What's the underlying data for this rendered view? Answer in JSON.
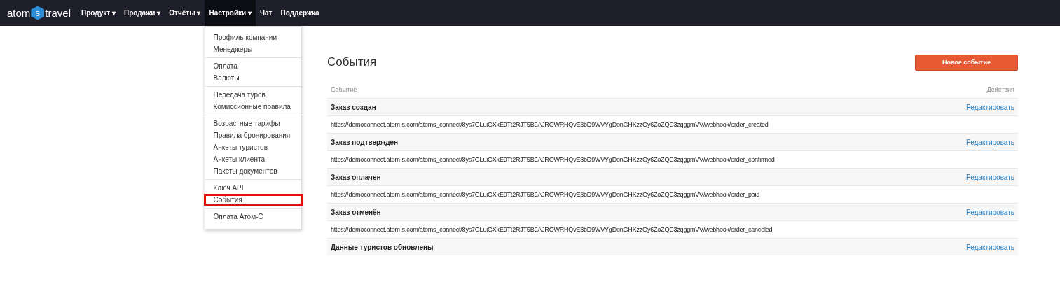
{
  "logo": {
    "left": "atom",
    "badge": "s",
    "right": "travel"
  },
  "nav": [
    {
      "label": "Продукт",
      "caret": "▾",
      "selected": false
    },
    {
      "label": "Продажи",
      "caret": "▾",
      "selected": false
    },
    {
      "label": "Отчёты",
      "caret": "▾",
      "selected": false
    },
    {
      "label": "Настройки",
      "caret": "▾",
      "selected": true
    },
    {
      "label": "Чат",
      "selected": false
    },
    {
      "label": "Поддержка",
      "selected": false
    }
  ],
  "menu": {
    "groups": [
      [
        {
          "label": "Профиль компании",
          "selected": false
        },
        {
          "label": "Менеджеры",
          "selected": false
        }
      ],
      [
        {
          "label": "Оплата",
          "selected": false
        },
        {
          "label": "Валюты",
          "selected": false
        }
      ],
      [
        {
          "label": "Передача туров",
          "selected": false
        },
        {
          "label": "Комиссионные правила",
          "selected": false
        }
      ],
      [
        {
          "label": "Возрастные тарифы",
          "selected": false
        },
        {
          "label": "Правила бронирования",
          "selected": false
        },
        {
          "label": "Анкеты туристов",
          "selected": false
        },
        {
          "label": "Анкеты клиента",
          "selected": false
        },
        {
          "label": "Пакеты документов",
          "selected": false
        }
      ],
      [
        {
          "label": "Ключ API",
          "selected": false
        },
        {
          "label": "События",
          "selected": true
        }
      ],
      [
        {
          "label": "Оплата Атом-С",
          "selected": false
        }
      ]
    ]
  },
  "page": {
    "title": "События",
    "new_button": "Новое событие"
  },
  "table": {
    "columns": [
      "Событие",
      "Действия"
    ],
    "rows": [
      {
        "name": "Заказ создан",
        "action": "Редактировать",
        "url": "https://democonnect.atom-s.com/atoms_connect/8ys7GLuiGXkE9Tt2RJT5B9AJROWRHQvE8bD9WVYgDonGHKzzGy6ZoZQC3zqggmVV/webhook/order_created"
      },
      {
        "name": "Заказ подтвержден",
        "action": "Редактировать",
        "url": "https://democonnect.atom-s.com/atoms_connect/8ys7GLuiGXkE9Tt2RJT5B9AJROWRHQvE8bD9WVYgDonGHKzzGy6ZoZQC3zqggmVV/webhook/order_confirmed"
      },
      {
        "name": "Заказ оплачен",
        "action": "Редактировать",
        "url": "https://democonnect.atom-s.com/atoms_connect/8ys7GLuiGXkE9Tt2RJT5B9AJROWRHQvE8bD9WVYgDonGHKzzGy6ZoZQC3zqggmVV/webhook/order_paid"
      },
      {
        "name": "Заказ отменён",
        "action": "Редактировать",
        "url": "https://democonnect.atom-s.com/atoms_connect/8ys7GLuiGXkE9Tt2RJT5B9AJROWRHQvE8bD9WVYgDonGHKzzGy6ZoZQC3zqggmVV/webhook/order_canceled"
      },
      {
        "name": "Данные туристов обновлены",
        "action": "Редактировать"
      }
    ]
  }
}
